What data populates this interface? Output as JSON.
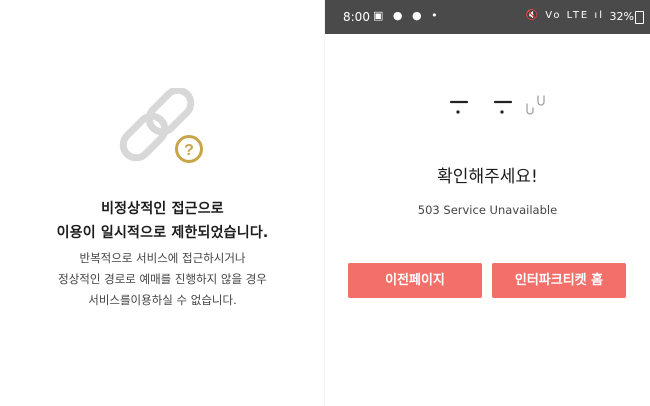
{
  "left": {
    "title_line1": "비정상적인 접근으로",
    "title_line2": "이용이 일시적으로 제한되었습니다.",
    "body_line1": "반복적으로 서비스에 접근하시거나",
    "body_line2": "정상적인 경로로 예매를 진행하지 않을 경우",
    "body_line3": "서비스를이용하실 수 없습니다.",
    "icon": "broken-link-icon",
    "badge_icon": "question-mark-icon",
    "colors": {
      "link": "#d8d8d8",
      "badge": "#c9a54a"
    }
  },
  "status_bar": {
    "time": "8:00",
    "left_icons": "▣ ● ● •",
    "right_icons": "🔇 Vo LTE ıl",
    "battery": "32%"
  },
  "right": {
    "face_icon": "sad-face-emoticon",
    "title": "확인해주세요!",
    "subtitle": "503 Service Unavailable",
    "buttons": {
      "prev": "이전페이지",
      "home": "인터파크티켓 홈"
    },
    "colors": {
      "button": "#f36f6a"
    }
  }
}
